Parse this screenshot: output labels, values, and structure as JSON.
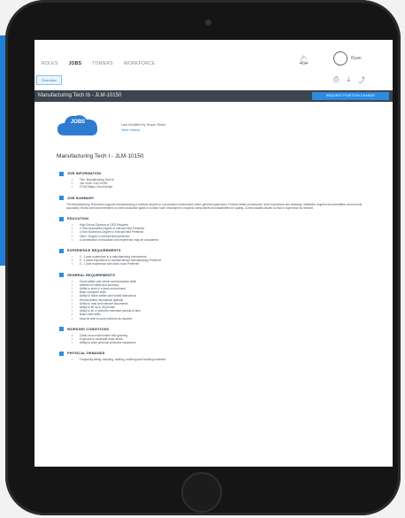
{
  "top_nav": [
    "ROLES",
    "JOBS",
    "TOWERS",
    "WORKFORCE"
  ],
  "active_nav_index": 1,
  "user_name": "Ryan",
  "sub_tab": "Overview",
  "doc_bar": {
    "title": "Manufacturing Tech Ib - JLM-10150",
    "action_label": "REQUEST POSITION CHANGE"
  },
  "logo_text": "JOBS",
  "meta": {
    "line1": "Last Modified by Susan Strain",
    "line2": "View History"
  },
  "heading": "Manufacturing Tech I - JLM-10150",
  "sections": [
    {
      "title": "JOB INFORMATION",
      "items": [
        "Title: Manufacturing Tech Ib",
        "Job Level: JLM-10150",
        "FLSA Status: Non-Exempt"
      ]
    },
    {
      "title": "JOB SUMMARY",
      "para": "The Manufacturing Technician supports manufacturing of medical devices in a production environment under general supervision. Follows written procedures, work instructions and drawings. Maintains required documentation and records accurately. Works with team members to meet production goals in a clean room environment. Inspects components and assemblies for quality. Communicates issues to lead or supervisor as needed."
    },
    {
      "title": "EDUCATION",
      "items": [
        "High School Diploma or GED Required",
        "2-Year Associates Degree in relevant field Preferred",
        "4-Year Bachelors Degree in relevant field Preferred",
        "Other: Degree in relevant field preferred",
        "A combination of education and experience may be considered"
      ]
    },
    {
      "title": "EXPERIENCE REQUIREMENTS",
      "items": [
        "0 - 1 year experience in a manufacturing environment",
        "0 - 2 years experience in medical device manufacturing Preferred",
        "0 - 1 year experience with clean room Preferred"
      ]
    },
    {
      "title": "GENERAL REQUIREMENTS",
      "items": [
        "Good written and verbal communication skills",
        "Attention to detail and accuracy",
        "Ability to work in a team environment",
        "Basic computer skills",
        "Ability to follow written and verbal instructions",
        "Demonstrated mechanical aptitude",
        "Ability to read and interpret documents",
        "Ability to lift up to 25 pounds",
        "Ability to sit or stand for extended periods of time",
        "Basic math skills",
        "Must be able to work overtime as required"
      ]
    },
    {
      "title": "WORKING CONDITIONS",
      "items": [
        "Clean room environment with gowning",
        "Exposure to moderate noise levels",
        "Ability to wear personal protective equipment"
      ]
    },
    {
      "title": "PHYSICAL DEMANDS",
      "items": [
        "Frequently sitting, standing, walking, reaching and handling materials"
      ]
    }
  ],
  "colors": {
    "accent": "#2d8be0",
    "doc_bar": "#3c4550",
    "bezel": "#151515"
  },
  "icons": [
    "bell-icon",
    "user-avatar-icon",
    "print-icon",
    "download-icon",
    "share-icon"
  ]
}
